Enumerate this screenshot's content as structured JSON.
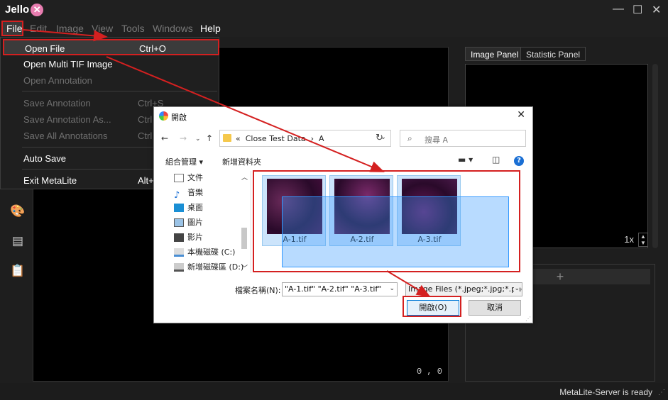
{
  "app": {
    "logo_text": "Jello",
    "logo_badge": "✕"
  },
  "window_controls": {
    "minimize": "—",
    "maximize": "☐",
    "close": "✕"
  },
  "menubar": {
    "file": "File",
    "edit": "Edit",
    "image": "Image",
    "view": "View",
    "tools": "Tools",
    "windows": "Windows",
    "help": "Help"
  },
  "file_menu": {
    "open_file": "Open File",
    "open_file_sc": "Ctrl+O",
    "open_multi_tif": "Open Multi TIF Image",
    "open_annotation": "Open Annotation",
    "save_annotation": "Save Annotation",
    "save_annotation_sc": "Ctrl+S",
    "save_annotation_as": "Save Annotation As...",
    "save_annotation_as_sc": "Ctrl",
    "save_all_annotations": "Save All Annotations",
    "save_all_annotations_sc": "Ctrl",
    "auto_save": "Auto Save",
    "exit": "Exit MetaLite",
    "exit_sc": "Alt+"
  },
  "canvas": {
    "coord_readout": "0 , 0"
  },
  "right_panel": {
    "tabs": [
      "Image Panel",
      "Statistic Panel"
    ],
    "zoom": "1x",
    "add_button": "+"
  },
  "status": {
    "text": "MetaLite-Server is ready"
  },
  "dialog": {
    "title": "開啟",
    "close": "✕",
    "path_prefix": "«",
    "path_folder": "Close Test Data",
    "path_sep": "›",
    "path_sub": "A",
    "search_placeholder": "搜尋 A",
    "organize": "組合管理 ▾",
    "new_folder": "新增資料夾",
    "nav_items": [
      "文件",
      "音樂",
      "桌面",
      "圖片",
      "影片",
      "本機磁碟 (C:)",
      "新增磁碟區 (D:)"
    ],
    "files": [
      "A-1.tif",
      "A-2.tif",
      "A-3.tif"
    ],
    "filename_label": "檔案名稱(N):",
    "filename_value": "\"A-1.tif\" \"A-2.tif\" \"A-3.tif\"",
    "filter_value": "Image Files (*.jpeg;*.jpg;*.png",
    "open_button": "開啟(O)",
    "cancel_button": "取消"
  },
  "colors": {
    "annotation_red": "#d42020",
    "selection_blue": "#3399ff",
    "thumbnail_purple": "#4a1a4a"
  }
}
